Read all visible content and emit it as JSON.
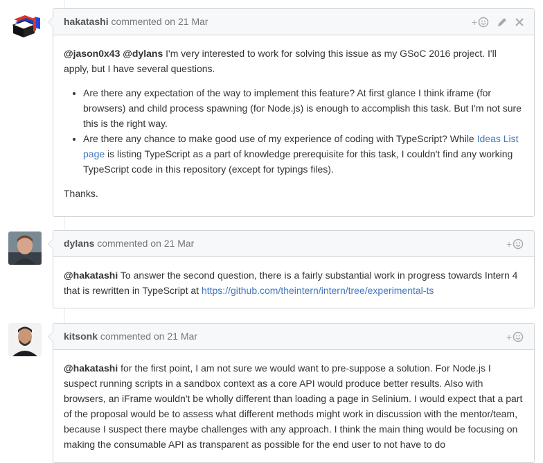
{
  "comments": [
    {
      "author": "hakatashi",
      "meta": "commented on 21 Mar",
      "mentions": [
        "@jason0x43",
        "@dylans"
      ],
      "intro": " I'm very interested to work for solving this issue as my GSoC 2016 project. I'll apply, but I have several questions.",
      "bullets": [
        {
          "text": "Are there any expectation of the way to implement this feature? At first glance I think iframe (for browsers) and child process spawning (for Node.js) is enough to accomplish this task. But I'm not sure this is the right way."
        },
        {
          "pre": "Are there any chance to make good use of my experience of coding with TypeScript? While ",
          "link": "Ideas List page",
          "post": " is listing TypeScript as a part of knowledge prerequisite for this task, I couldn't find any working TypeScript code in this repository (except for typings files)."
        }
      ],
      "closing": "Thanks."
    },
    {
      "author": "dylans",
      "meta": "commented on 21 Mar",
      "mention": "@hakatashi",
      "text": " To answer the second question, there is a fairly substantial work in progress towards Intern 4 that is rewritten in TypeScript at ",
      "link": "https://github.com/theintern/intern/tree/experimental-ts"
    },
    {
      "author": "kitsonk",
      "meta": "commented on 21 Mar",
      "mention": "@hakatashi",
      "text": " for the first point, I am not sure we would want to pre-suppose a solution. For Node.js I suspect running scripts in a sandbox context as a core API would produce better results. Also with browsers, an iFrame wouldn't be wholly different than loading a page in Selinium. I would expect that a part of the proposal would be to assess what different methods might work in discussion with the mentor/team, because I suspect there maybe challenges with any approach. I think the main thing would be focusing on making the consumable API as transparent as possible for the end user to not have to do"
    }
  ],
  "icons": {
    "reaction": "add-reaction-icon",
    "edit": "pencil-icon",
    "delete": "close-icon"
  },
  "colors": {
    "link": "#4078c0",
    "header_bg": "#f6f8fa",
    "border": "#d1d5da"
  }
}
